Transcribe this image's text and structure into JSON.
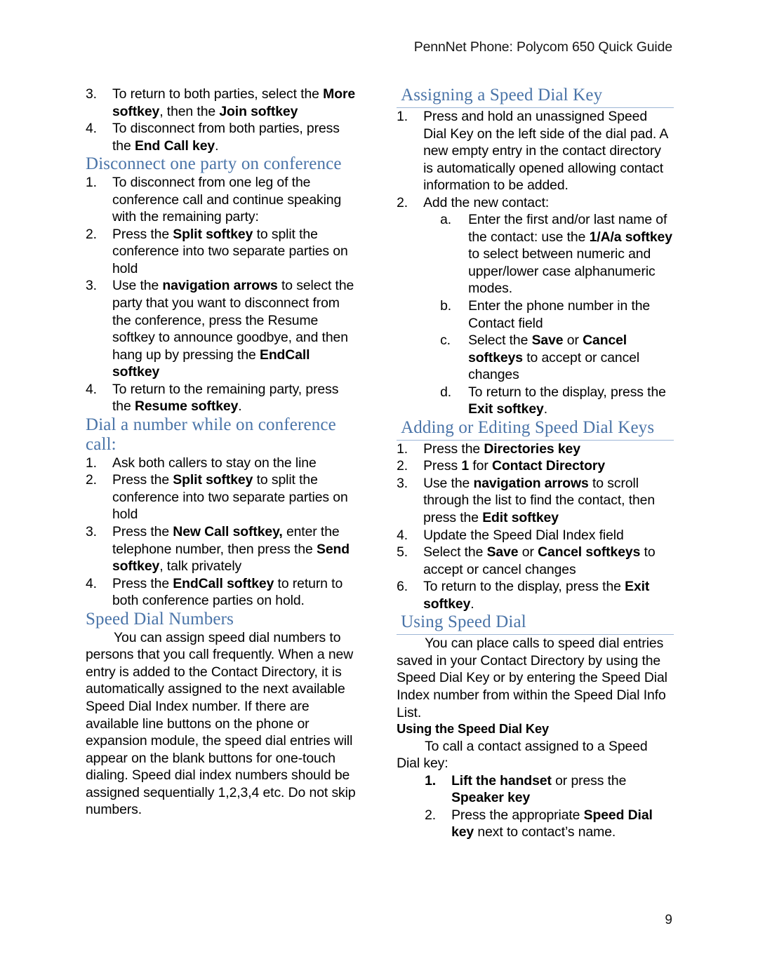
{
  "header": {
    "running_title": "PennNet Phone: Polycom 650 Quick Guide"
  },
  "footer": {
    "page_number": "9"
  },
  "colors": {
    "heading_blue": "#4A74A8",
    "rule_blue": "#9DB6D6",
    "body_text": "#000000"
  },
  "left_column": {
    "continued_list": {
      "items": [
        {
          "marker": "3.",
          "html": "To return to both parties, select the <b>More softkey</b>, then the <b>Join softkey</b>"
        },
        {
          "marker": "4.",
          "html": "To disconnect from both parties, press the <b>End Call key</b>."
        }
      ]
    },
    "section_disconnect": {
      "heading": "Disconnect one party on conference",
      "items": [
        {
          "marker": "1.",
          "html": "To disconnect from one leg of the conference call and continue speaking with the remaining party:"
        },
        {
          "marker": "2.",
          "html": "Press the <b>Split softkey</b> to split the conference into two separate parties on hold"
        },
        {
          "marker": "3.",
          "html": "Use the <b>navigation arrows</b> to select the party that you want to disconnect from the conference, press the Resume softkey to announce goodbye, and then hang up by pressing the <b>EndCall softkey</b>"
        },
        {
          "marker": "4.",
          "html": "To return to the remaining party, press the <b>Resume softkey</b>."
        }
      ]
    },
    "section_dial_while_conf": {
      "heading": "Dial a number while on conference call:",
      "items": [
        {
          "marker": "1.",
          "html": "Ask both callers to stay on the line"
        },
        {
          "marker": "2.",
          "html": "Press the <b>Split softkey</b> to split the conference into two separate parties on hold"
        },
        {
          "marker": "3.",
          "html": "Press the <b>New Call softkey,</b> enter the telephone number, then press the <b>Send softkey</b>, talk privately"
        },
        {
          "marker": "4.",
          "html": "Press the <b>EndCall softkey</b> to return to both conference parties on hold."
        }
      ]
    },
    "section_speed_dial_numbers": {
      "heading": "Speed Dial Numbers",
      "paragraph": "You can assign speed dial numbers to persons that you call frequently. When a new entry is added to the Contact Directory, it is automatically assigned to the next available Speed Dial Index number.  If there are available line buttons on the phone or expansion module, the speed dial entries will appear on the blank buttons for one-touch dialing. Speed dial index numbers should be assigned sequentially 1,2,3,4 etc. Do not skip numbers."
    }
  },
  "right_column": {
    "section_assigning": {
      "heading": "Assigning a Speed Dial Key",
      "items": [
        {
          "marker": "1.",
          "html": "Press and hold an unassigned Speed Dial Key on the left side of the dial pad. A new empty entry in the contact directory is automatically opened allowing contact information to be added."
        },
        {
          "marker": "2.",
          "html": "Add the new contact:"
        }
      ],
      "subitems": [
        {
          "marker": "a.",
          "html": "Enter the first and/or last name of the contact: use the <b>1/A/a softkey</b> to select between numeric and upper/lower case alphanumeric modes."
        },
        {
          "marker": "b.",
          "html": "Enter the phone number in the Contact field"
        },
        {
          "marker": "c.",
          "html": "Select the <b>Save</b> or <b>Cancel softkeys</b> to accept or cancel changes"
        },
        {
          "marker": "d.",
          "html": "To return to the display, press the <b>Exit softkey</b>."
        }
      ]
    },
    "section_adding_editing": {
      "heading": "Adding or Editing Speed Dial Keys",
      "items": [
        {
          "marker": "1.",
          "html": "Press the <b>Directories key</b>"
        },
        {
          "marker": "2.",
          "html": "Press <b>1</b> for <b>Contact Directory</b>"
        },
        {
          "marker": "3.",
          "html": "Use the <b>navigation arrows</b> to scroll through the list to find the contact, then press the <b>Edit softkey</b>"
        },
        {
          "marker": "4.",
          "html": "Update the Speed Dial Index field"
        },
        {
          "marker": "5.",
          "html": "Select the <b>Save</b> or <b>Cancel softkeys</b> to accept or cancel changes"
        },
        {
          "marker": "6.",
          "html": "To return to the display, press the <b>Exit softkey</b>."
        }
      ]
    },
    "section_using_speed_dial": {
      "heading": "Using Speed Dial",
      "paragraph": "You can place calls to speed dial entries saved in your Contact Directory by using the Speed Dial Key or by entering the Speed Dial Index number from within the Speed Dial Info List.",
      "subheading": "Using the Speed Dial Key",
      "paragraph2": "To call a contact assigned to a Speed Dial key:",
      "items": [
        {
          "marker": "1.",
          "marker_bold": true,
          "html": "<b>Lift the handset</b> or press the <b>Speaker key</b>"
        },
        {
          "marker": "2.",
          "marker_bold": false,
          "html": "Press the appropriate <b>Speed Dial key</b> next to contact’s name."
        }
      ]
    }
  }
}
